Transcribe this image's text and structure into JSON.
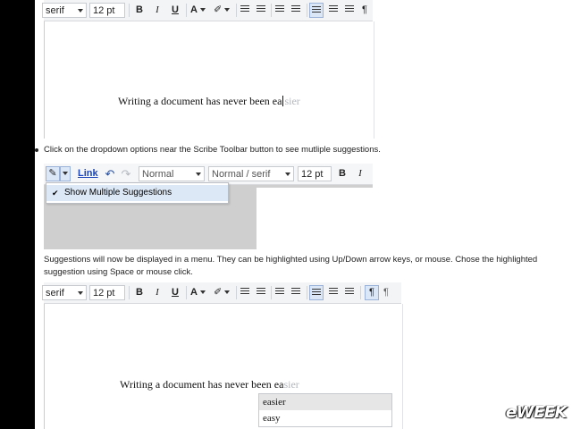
{
  "toolbar1": {
    "font_family": "serif",
    "font_size": "12 pt",
    "bold": "B",
    "italic": "I",
    "underline": "U",
    "text_color": "A"
  },
  "editor1": {
    "text_prefix": "Writing a document has never been ea",
    "text_ghost": "sier"
  },
  "bullet_text": "Click on the dropdown options near the Scribe Toolbar button to see mutliple suggestions.",
  "toolbar2": {
    "pencil": "✎",
    "link_label": "Link",
    "undo": "↶",
    "redo": "↷",
    "style_select": "Normal",
    "font_select": "Normal / serif",
    "font_size": "12 pt",
    "bold": "B",
    "italic": "I"
  },
  "dropdown_menu": {
    "check": "✔",
    "item_label": "Show Multiple Suggestions"
  },
  "paragraph_text": "Suggestions will now be displayed in a menu. They can be highlighted using Up/Down arrow keys, or mouse. Chose the highlighted suggestion using Space or mouse click.",
  "toolbar3": {
    "font_family": "serif",
    "font_size": "12 pt",
    "bold": "B",
    "italic": "I",
    "underline": "U",
    "text_color": "A"
  },
  "editor3": {
    "text_prefix": "Writing a document has never been ea",
    "text_ghost": "sier"
  },
  "suggestions": [
    "easier",
    "easy"
  ],
  "watermark": "eWEEK"
}
